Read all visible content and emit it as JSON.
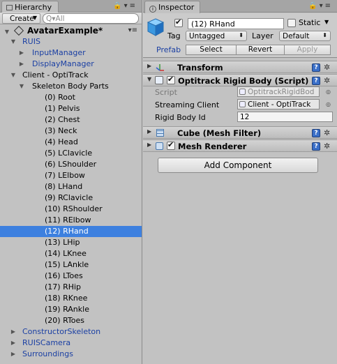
{
  "hierarchy": {
    "tab_label": "Hierarchy",
    "create_label": "Create",
    "search_placeholder": "Q▾All",
    "scene_name": "AvatarExample*",
    "items": [
      {
        "label": "RUIS",
        "depth": 1,
        "arrow": "▼",
        "blue": true
      },
      {
        "label": "InputManager",
        "depth": 2,
        "arrow": "▶",
        "blue": true
      },
      {
        "label": "DisplayManager",
        "depth": 2,
        "arrow": "▶",
        "blue": true
      },
      {
        "label": "Client - OptiTrack",
        "depth": 1,
        "arrow": "▼",
        "blue": false
      },
      {
        "label": "Skeleton Body Parts",
        "depth": 2,
        "arrow": "▼",
        "blue": false
      },
      {
        "label": "(0) Root",
        "depth": 3,
        "arrow": "",
        "blue": false
      },
      {
        "label": "(1) Pelvis",
        "depth": 3,
        "arrow": "",
        "blue": false
      },
      {
        "label": "(2) Chest",
        "depth": 3,
        "arrow": "",
        "blue": false
      },
      {
        "label": "(3) Neck",
        "depth": 3,
        "arrow": "",
        "blue": false
      },
      {
        "label": "(4) Head",
        "depth": 3,
        "arrow": "",
        "blue": false
      },
      {
        "label": "(5) LClavicle",
        "depth": 3,
        "arrow": "",
        "blue": false
      },
      {
        "label": "(6) LShoulder",
        "depth": 3,
        "arrow": "",
        "blue": false
      },
      {
        "label": "(7) LElbow",
        "depth": 3,
        "arrow": "",
        "blue": false
      },
      {
        "label": "(8) LHand",
        "depth": 3,
        "arrow": "",
        "blue": false
      },
      {
        "label": "(9) RClavicle",
        "depth": 3,
        "arrow": "",
        "blue": false
      },
      {
        "label": "(10) RShoulder",
        "depth": 3,
        "arrow": "",
        "blue": false
      },
      {
        "label": "(11) RElbow",
        "depth": 3,
        "arrow": "",
        "blue": false
      },
      {
        "label": "(12) RHand",
        "depth": 3,
        "arrow": "",
        "blue": false,
        "selected": true
      },
      {
        "label": "(13) LHip",
        "depth": 3,
        "arrow": "",
        "blue": false
      },
      {
        "label": "(14) LKnee",
        "depth": 3,
        "arrow": "",
        "blue": false
      },
      {
        "label": "(15) LAnkle",
        "depth": 3,
        "arrow": "",
        "blue": false
      },
      {
        "label": "(16) LToes",
        "depth": 3,
        "arrow": "",
        "blue": false
      },
      {
        "label": "(17) RHip",
        "depth": 3,
        "arrow": "",
        "blue": false
      },
      {
        "label": "(18) RKnee",
        "depth": 3,
        "arrow": "",
        "blue": false
      },
      {
        "label": "(19) RAnkle",
        "depth": 3,
        "arrow": "",
        "blue": false
      },
      {
        "label": "(20) RToes",
        "depth": 3,
        "arrow": "",
        "blue": false
      },
      {
        "label": "ConstructorSkeleton",
        "depth": 0,
        "arrow": "▶",
        "blue": true
      },
      {
        "label": "RUISCamera",
        "depth": 0,
        "arrow": "▶",
        "blue": true
      },
      {
        "label": "Surroundings",
        "depth": 0,
        "arrow": "▶",
        "blue": true
      }
    ]
  },
  "inspector": {
    "tab_label": "Inspector",
    "object_name": "(12) RHand",
    "static_label": "Static",
    "tag_label": "Tag",
    "tag_value": "Untagged",
    "layer_label": "Layer",
    "layer_value": "Default",
    "prefab_label": "Prefab",
    "prefab_select": "Select",
    "prefab_revert": "Revert",
    "prefab_apply": "Apply",
    "components": {
      "transform": "Transform",
      "rigidbody": "Optitrack Rigid Body (Script)",
      "meshfilter": "Cube (Mesh Filter)",
      "meshrenderer": "Mesh Renderer"
    },
    "rigidbody_fields": {
      "script_label": "Script",
      "script_value": "OptitrackRigidBod",
      "client_label": "Streaming Client",
      "client_value": "Client - OptiTrack",
      "id_label": "Rigid Body Id",
      "id_value": "12"
    },
    "add_component": "Add Component"
  },
  "colors": {
    "selection": "#3d80df",
    "prefab_blue": "#1a3fa3",
    "panel_bg": "#c2c2c2"
  }
}
